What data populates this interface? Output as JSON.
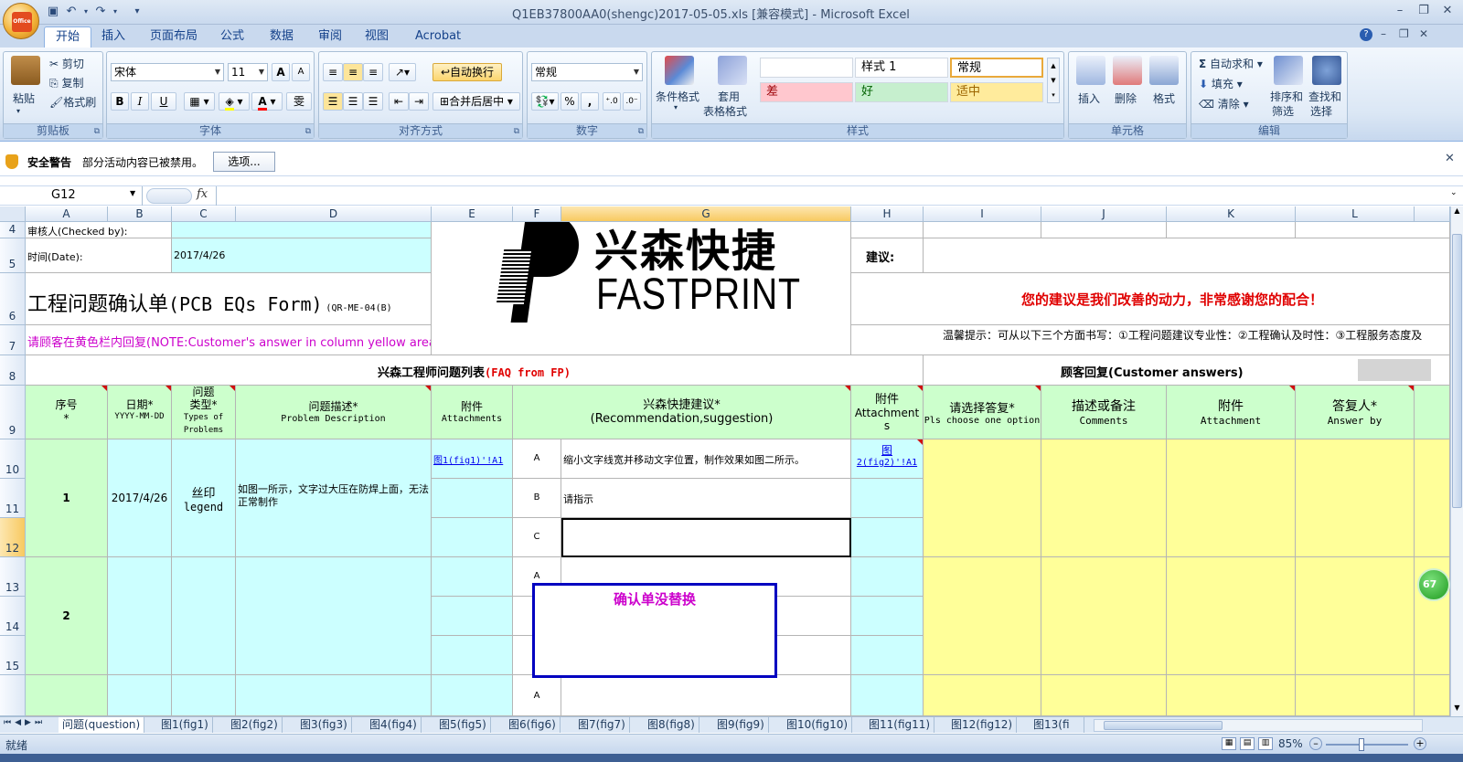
{
  "window": {
    "title": "Q1EB37800AA0(shengc)2017-05-05.xls [兼容模式] - Microsoft Excel",
    "office_logo": "Office"
  },
  "tabs": [
    "开始",
    "插入",
    "页面布局",
    "公式",
    "数据",
    "审阅",
    "视图",
    "Acrobat"
  ],
  "ribbon": {
    "clipboard": {
      "paste": "粘贴",
      "cut": "剪切",
      "copy": "复制",
      "format_painter": "格式刷",
      "label": "剪贴板"
    },
    "font": {
      "name": "宋体",
      "size": "11",
      "label": "字体",
      "bold": "B",
      "italic": "I",
      "underline": "U",
      "grow": "A",
      "shrink": "A",
      "font_color_letter": "A",
      "phonetic": "雯"
    },
    "alignment": {
      "wrap": "自动换行",
      "merge": "合并后居中",
      "label": "对齐方式"
    },
    "number": {
      "format": "常规",
      "percent": "%",
      "comma": ",",
      "label": "数字"
    },
    "styles": {
      "conditional": "条件格式",
      "table_line1": "套用",
      "table_line2": "表格格式",
      "cells": [
        "",
        "样式 1",
        "常规",
        "差",
        "好",
        "适中"
      ],
      "label": "样式"
    },
    "cells_group": {
      "insert": "插入",
      "delete": "删除",
      "format": "格式",
      "label": "单元格"
    },
    "editing": {
      "autosum": "自动求和",
      "fill": "填充",
      "clear": "清除",
      "sort_line1": "排序和",
      "sort_line2": "筛选",
      "find_line1": "查找和",
      "find_line2": "选择",
      "label": "编辑"
    }
  },
  "security": {
    "title": "安全警告",
    "message": "部分活动内容已被禁用。",
    "options_btn": "选项..."
  },
  "formula_bar": {
    "name_box": "G12",
    "fx": "fx",
    "value": ""
  },
  "columns": [
    "A",
    "B",
    "C",
    "D",
    "E",
    "F",
    "G",
    "H",
    "I",
    "J",
    "K",
    "L"
  ],
  "rows": [
    "4",
    "5",
    "6",
    "7",
    "8",
    "9",
    "10",
    "11",
    "12",
    "13",
    "14",
    "15"
  ],
  "cells": {
    "checked_by": "审核人(Checked by):",
    "date_label": "时间(Date):",
    "date_value": "2017/4/26",
    "form_title": "工程问题确认单",
    "form_title_en": "(PCB EQs Form)",
    "form_code": "(QR-ME-04(B)",
    "note": "请顾客在黄色栏内回复(NOTE:Customer's answer in column yellow area)",
    "suggestion_label": "建议:",
    "thanks": "您的建议是我们改善的动力，非常感谢您的配合！",
    "tips": "温馨提示：可从以下三个方面书写：①工程问题建议专业性：②工程确认及时性：③工程服务态度及",
    "fp_list": "兴森工程师问题列表",
    "fp_list_en": "(FAQ from FP)",
    "customer_answers": "顾客回复(Customer answers)",
    "logo_cn": "兴森快捷",
    "logo_en": "FASTPRINT",
    "row4_partial": [
      "",
      "",
      "",
      ""
    ]
  },
  "headers": {
    "seq": "序号",
    "seq2": "*",
    "date": "日期*",
    "date2": "YYYY-MM-DD",
    "type1": "问题",
    "type2": "类型*",
    "type3": "Types of",
    "type4": "Problems",
    "desc": "问题描述*",
    "desc2": "Problem Description",
    "attach": "附件",
    "attach2": "Attachments",
    "rec": "兴森快捷建议*",
    "rec2": "(Recommendation,suggestion)",
    "attach_h": "附件",
    "attach_h2": "Attachment",
    "attach_h3": "s",
    "choose": "请选择答复*",
    "choose2": "Pls choose one option",
    "comments": "描述或备注",
    "comments2": "Comments",
    "attach_k": "附件",
    "attach_k2": "Attachment",
    "answer": "答复人*",
    "answer2": "Answer by"
  },
  "items": [
    {
      "no": "1",
      "date": "2017/4/26",
      "type": "丝印",
      "type_en": "legend",
      "desc": "如图一所示，文字过大压在防焊上面，无法正常制作",
      "link_e": "图1(fig1)'!A1",
      "options": [
        "A",
        "B",
        "C"
      ],
      "suggestions": [
        "缩小文字线宽并移动文字位置，制作效果如图二所示。",
        "请指示",
        ""
      ],
      "link_h1": "图",
      "link_h2": "2(fig2)'!A1"
    },
    {
      "no": "2",
      "options": [
        "A"
      ]
    },
    {
      "options": [
        "A"
      ]
    }
  ],
  "popup": {
    "text": "确认单没替换"
  },
  "sheet_tabs": [
    "问题(question)",
    "图1(fig1)",
    "图2(fig2)",
    "图3(fig3)",
    "图4(fig4)",
    "图5(fig5)",
    "图6(fig6)",
    "图7(fig7)",
    "图8(fig8)",
    "图9(fig9)",
    "图10(fig10)",
    "图11(fig11)",
    "图12(fig12)",
    "图13(fi"
  ],
  "status": {
    "ready": "就绪",
    "zoom": "85%",
    "badge": "67"
  },
  "colors": {
    "cyan": "#ccffff",
    "green": "#ccffcc",
    "yellow": "#ffff99",
    "accent": "#15428b",
    "red_text": "#e00000",
    "magenta": "#cc00cc"
  }
}
